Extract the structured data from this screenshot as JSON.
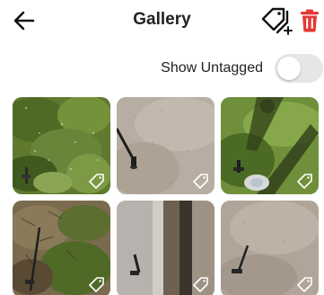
{
  "header": {
    "title": "Gallery",
    "back_icon": "arrow-left-icon",
    "tag_add_icon": "tags-plus-icon",
    "delete_icon": "trash-icon"
  },
  "filter": {
    "show_untagged_label": "Show Untagged",
    "show_untagged_on": false
  },
  "colors": {
    "delete": "#e53935",
    "toggle_off": "#e6e6e6",
    "text": "#222222"
  },
  "gallery": {
    "thumbnails": [
      {
        "subject": "grass"
      },
      {
        "subject": "pavement"
      },
      {
        "subject": "grass-shadow"
      },
      {
        "subject": "dirt-grass"
      },
      {
        "subject": "curb-pavement"
      },
      {
        "subject": "pavement"
      }
    ]
  }
}
